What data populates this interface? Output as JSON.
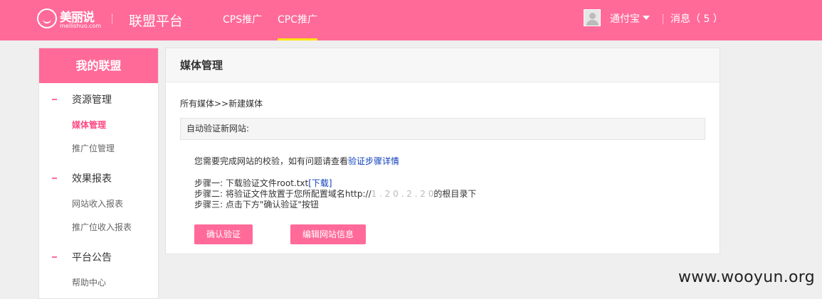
{
  "brand": {
    "name": "美丽说",
    "domain": "meilishuo.com",
    "color": "#ff6a99"
  },
  "header": {
    "platform_title": "联盟平台",
    "tabs": [
      {
        "label": "CPS推广",
        "active": false
      },
      {
        "label": "CPC推广",
        "active": true
      }
    ],
    "user_name": "通付宝",
    "messages_label": "消息（ 5 ）"
  },
  "sidebar": {
    "title": "我的联盟",
    "sections": [
      {
        "label": "资源管理",
        "items": [
          {
            "label": "媒体管理",
            "active": true
          },
          {
            "label": "推广位管理",
            "active": false
          }
        ]
      },
      {
        "label": "效果报表",
        "items": [
          {
            "label": "网站收入报表"
          },
          {
            "label": "推广位收入报表"
          }
        ]
      },
      {
        "label": "平台公告",
        "items": [
          {
            "label": "帮助中心"
          }
        ]
      }
    ]
  },
  "main": {
    "title": "媒体管理",
    "breadcrumb": "所有媒体>>新建媒体",
    "auto_verify_label": "自动验证新网站:",
    "instruction_prefix": "您需要完成网站的校验，如有问题请查看",
    "instruction_link": "验证步骤详情",
    "step1_prefix": "步骤一: 下载验证文件root.txt",
    "step1_link": "[下载]",
    "step2_prefix": "步骤二: 将验证文件放置于您所配置域名http://",
    "step2_redacted": "1 . 2 0 . 2 . 2 0",
    "step2_suffix": "的根目录下",
    "step3": "步骤三: 点击下方\"确认验证\"按钮",
    "confirm_button": "确认验证",
    "edit_button": "编辑网站信息"
  },
  "watermark": "www.wooyun.org"
}
